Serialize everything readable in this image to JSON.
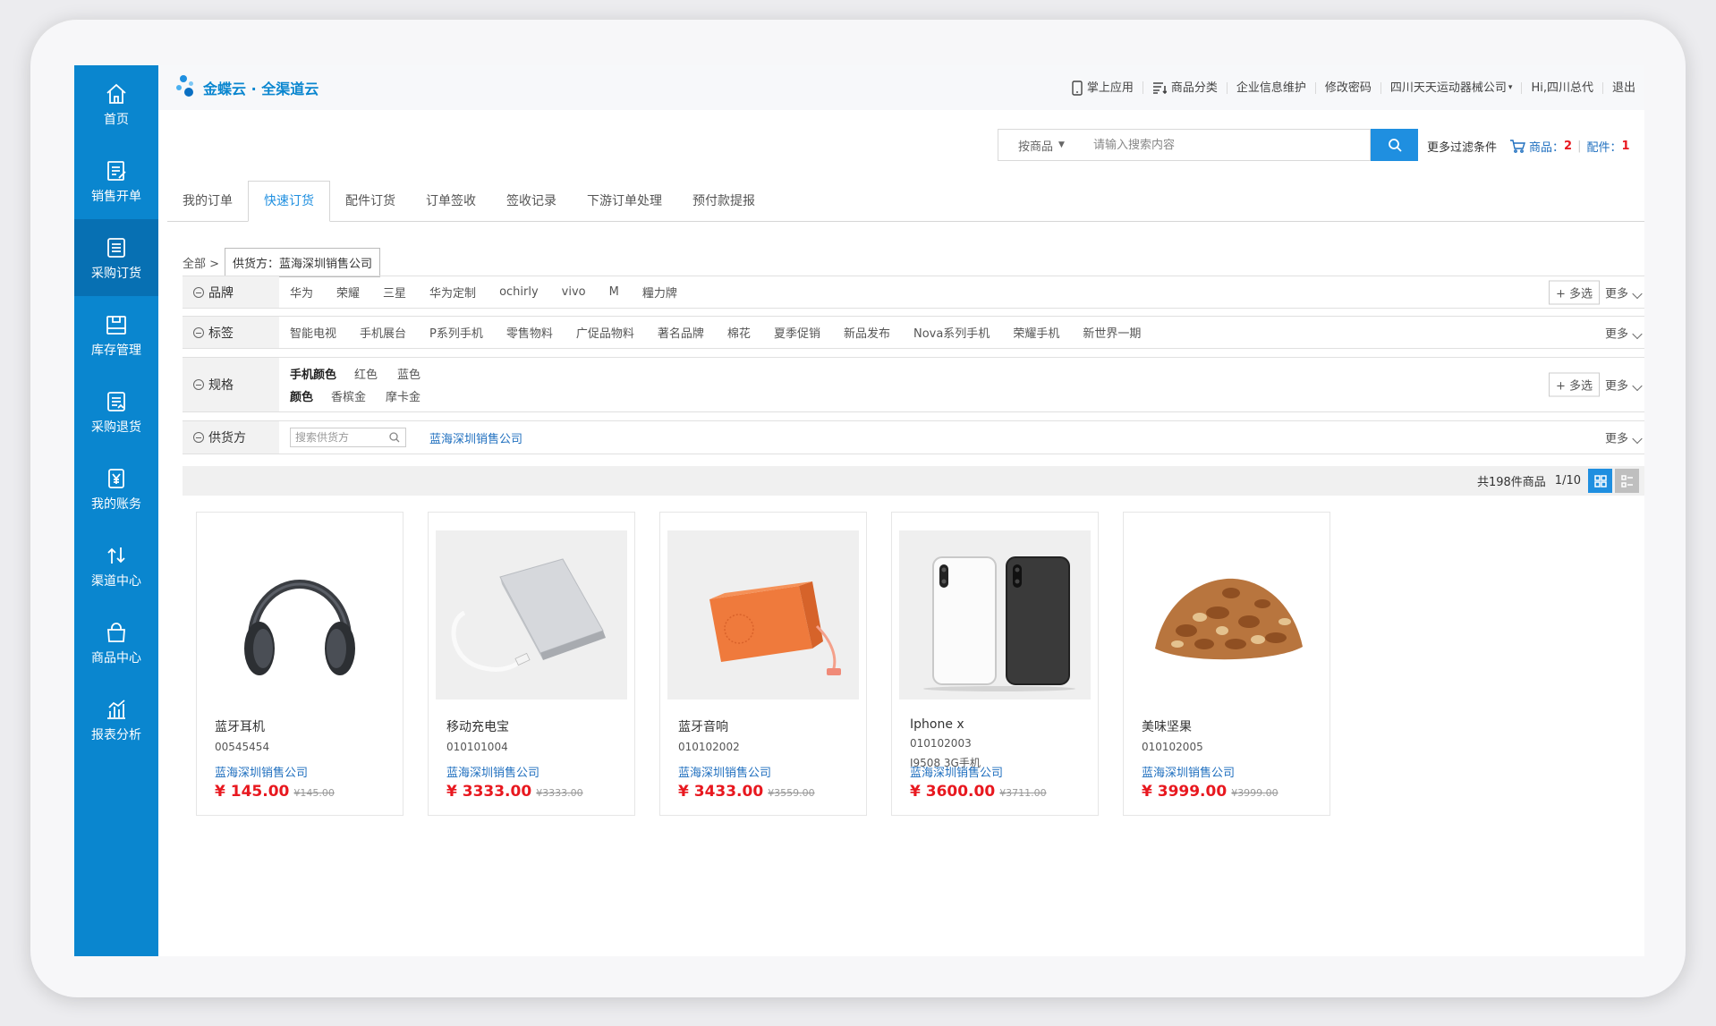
{
  "sidebar": {
    "items": [
      {
        "label": "首页",
        "icon": "home-icon"
      },
      {
        "label": "销售开单",
        "icon": "edit-document-icon"
      },
      {
        "label": "采购订货",
        "icon": "order-document-icon",
        "active": true
      },
      {
        "label": "库存管理",
        "icon": "inventory-box-icon"
      },
      {
        "label": "采购退货",
        "icon": "return-document-icon"
      },
      {
        "label": "我的账务",
        "icon": "yen-account-icon"
      },
      {
        "label": "渠道中心",
        "icon": "channel-arrows-icon"
      },
      {
        "label": "商品中心",
        "icon": "shopping-bag-icon"
      },
      {
        "label": "报表分析",
        "icon": "bar-chart-icon"
      }
    ]
  },
  "header": {
    "logo_text": "金蝶云 · 全渠道云",
    "nav": [
      "掌上应用",
      "商品分类",
      "企业信息维护",
      "修改密码",
      "四川天天运动器械公司",
      "Hi,四川总代",
      "退出"
    ]
  },
  "search": {
    "type_label": "按商品",
    "placeholder": "请输入搜索内容",
    "more_filter": "更多过滤条件",
    "cart_goods_label": "商品：",
    "cart_goods_count": "2",
    "cart_parts_label": "配件：",
    "cart_parts_count": "1"
  },
  "tabs": [
    "我的订单",
    "快速订货",
    "配件订货",
    "订单签收",
    "签收记录",
    "下游订单处理",
    "预付款提报"
  ],
  "active_tab": 1,
  "breadcrumb": {
    "root": "全部 >",
    "tag": "供货方：蓝海深圳销售公司"
  },
  "filters": {
    "brand": {
      "label": "品牌",
      "values": [
        "华为",
        "荣耀",
        "三星",
        "华为定制",
        "ochirly",
        "vivo",
        "M",
        "糧力牌"
      ]
    },
    "tag": {
      "label": "标签",
      "values": [
        "智能电视",
        "手机展台",
        "P系列手机",
        "零售物料",
        "广促品物料",
        "著名品牌",
        "棉花",
        "夏季促销",
        "新品发布",
        "Nova系列手机",
        "荣耀手机",
        "新世界一期"
      ]
    },
    "spec": {
      "label": "规格",
      "rows": [
        {
          "name": "手机颜色",
          "values": [
            "红色",
            "蓝色"
          ]
        },
        {
          "name": "颜色",
          "values": [
            "香槟金",
            "摩卡金"
          ]
        }
      ]
    },
    "supplier": {
      "label": "供货方",
      "placeholder": "搜索供货方",
      "value": "蓝海深圳销售公司"
    },
    "multi_label": "+ 多选",
    "more_label": "更多"
  },
  "listbar": {
    "total": "共198件商品",
    "page": "1/10"
  },
  "products": [
    {
      "name": "蓝牙耳机",
      "code": "00545454",
      "spec": "",
      "supplier": "蓝海深圳销售公司",
      "price": "¥ 145.00",
      "orig": "¥145.00"
    },
    {
      "name": "移动充电宝",
      "code": "010101004",
      "spec": "",
      "supplier": "蓝海深圳销售公司",
      "price": "¥ 3333.00",
      "orig": "¥3333.00"
    },
    {
      "name": "蓝牙音响",
      "code": "010102002",
      "spec": "",
      "supplier": "蓝海深圳销售公司",
      "price": "¥ 3433.00",
      "orig": "¥3559.00"
    },
    {
      "name": "Iphone  x",
      "code": "010102003",
      "spec": "I9508 3G手机",
      "supplier": "蓝海深圳销售公司",
      "price": "¥ 3600.00",
      "orig": "¥3711.00"
    },
    {
      "name": "美味坚果",
      "code": "010102005",
      "spec": "",
      "supplier": "蓝海深圳销售公司",
      "price": "¥ 3999.00",
      "orig": "¥3999.00"
    }
  ],
  "colors": {
    "sidebar": "#0a86cf",
    "accent": "#1f8fe0",
    "price": "#e8181f",
    "link": "#1f6fbf"
  }
}
